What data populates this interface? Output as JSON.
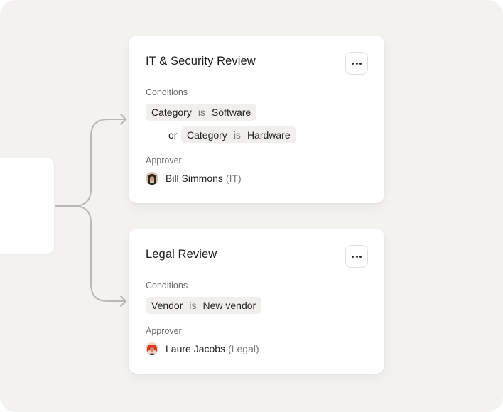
{
  "workflow": {
    "cards": [
      {
        "title": "IT & Security Review",
        "conditions_label": "Conditions",
        "conditions": [
          {
            "field": "Category",
            "operator": "is",
            "value": "Software"
          },
          {
            "connector": "or",
            "field": "Category",
            "operator": "is",
            "value": "Hardware"
          }
        ],
        "approver_label": "Approver",
        "approver": {
          "name": "Bill Simmons",
          "dept": "(IT)"
        }
      },
      {
        "title": "Legal Review",
        "conditions_label": "Conditions",
        "conditions": [
          {
            "field": "Vendor",
            "operator": "is",
            "value": "New vendor"
          }
        ],
        "approver_label": "Approver",
        "approver": {
          "name": "Laure Jacobs",
          "dept": "(Legal)"
        }
      }
    ]
  },
  "colors": {
    "canvas": "#f3f2ef",
    "card": "#ffffff",
    "chip": "#f0efec",
    "connector": "#b9b8b4"
  },
  "icons": {
    "menu": "more-horizontal-icon",
    "arrow": "arrow-right-icon"
  }
}
